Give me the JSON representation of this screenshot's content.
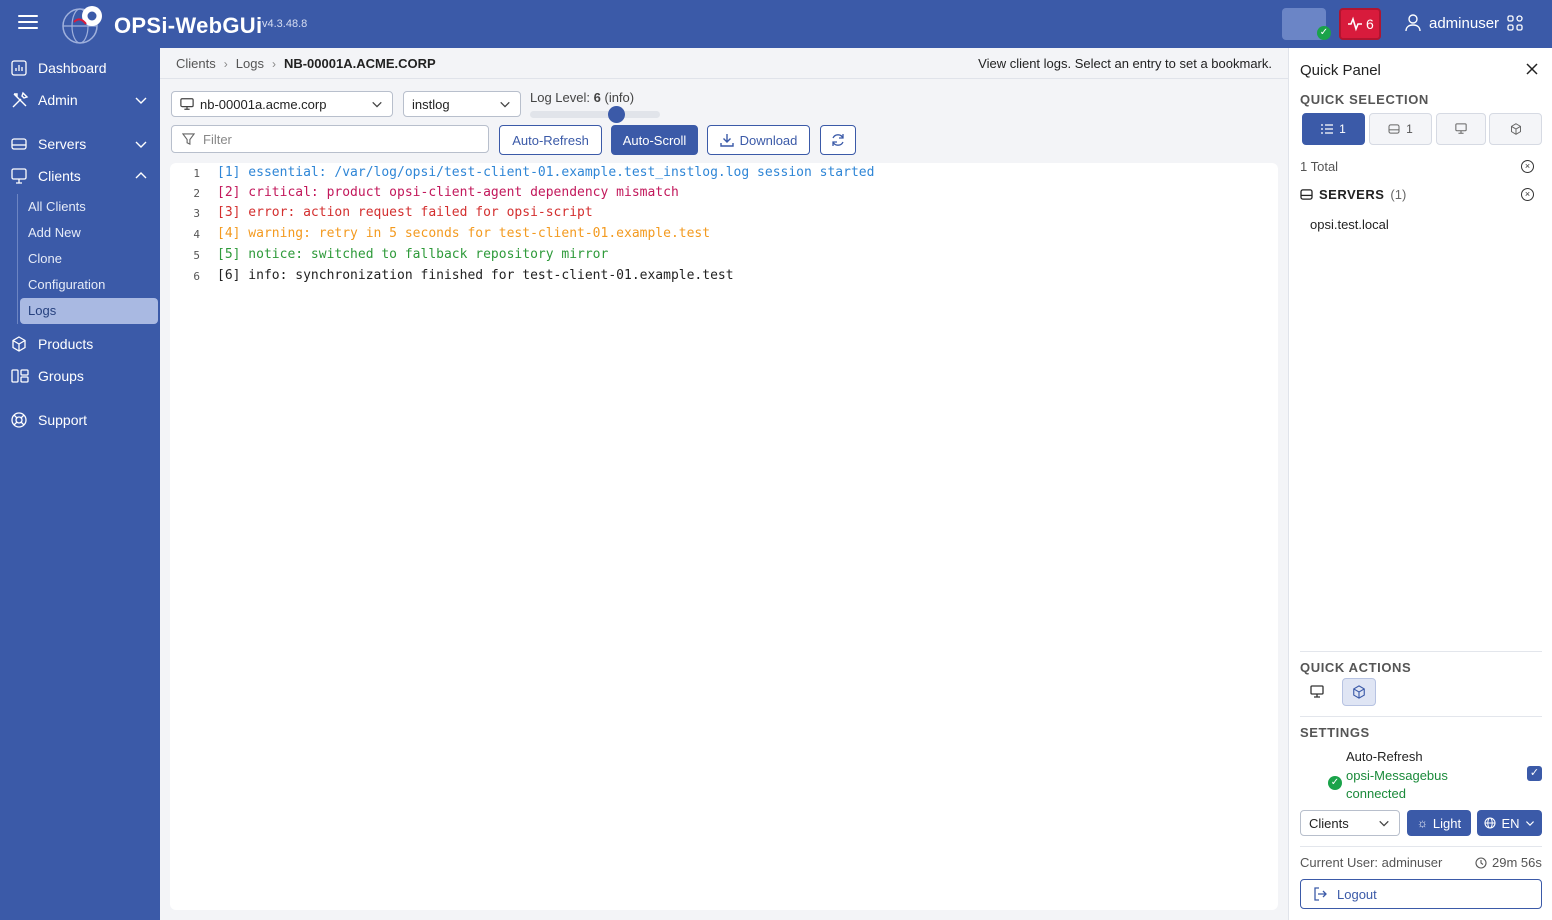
{
  "header": {
    "app_name": "OPSi-WebGUi",
    "version": "v4.3.48.8",
    "alert_count": "6",
    "username": "adminuser"
  },
  "sidebar": {
    "items": [
      {
        "label": "Dashboard",
        "icon": "dashboard-icon"
      },
      {
        "label": "Admin",
        "icon": "admin-tools-icon"
      },
      {
        "label": "Servers",
        "icon": "server-icon"
      },
      {
        "label": "Clients",
        "icon": "monitor-icon"
      },
      {
        "label": "Products",
        "icon": "package-icon"
      },
      {
        "label": "Groups",
        "icon": "groups-icon"
      },
      {
        "label": "Support",
        "icon": "lifebuoy-icon"
      }
    ],
    "client_subitems": [
      "All Clients",
      "Add New",
      "Clone",
      "Configuration",
      "Logs"
    ],
    "active_subitem": "Logs"
  },
  "breadcrumb": {
    "items": [
      "Clients",
      "Logs"
    ],
    "current": "NB-00001A.ACME.CORP"
  },
  "hint_text": "View client logs. Select an entry to set a bookmark.",
  "toolbar": {
    "client_select": "nb-00001a.acme.corp",
    "log_type_select": "instlog",
    "log_level_label": "Log Level:",
    "log_level_value": "6",
    "log_level_name": "(info)",
    "log_level_max": 9,
    "filter_placeholder": "Filter",
    "auto_refresh_label": "Auto-Refresh",
    "auto_scroll_label": "Auto-Scroll",
    "download_label": "Download"
  },
  "log_lines": [
    {
      "num": "1",
      "text": "[1] essential: /var/log/opsi/test-client-01.example.test_instlog.log session started",
      "color": "#2f86d6"
    },
    {
      "num": "2",
      "text": "[2] critical: product opsi-client-agent dependency mismatch",
      "color": "#c2185b"
    },
    {
      "num": "3",
      "text": "[3] error: action request failed for opsi-script",
      "color": "#d32f2f"
    },
    {
      "num": "4",
      "text": "[4] warning: retry in 5 seconds for test-client-01.example.test",
      "color": "#f39a1f"
    },
    {
      "num": "5",
      "text": "[5] notice: switched to fallback repository mirror",
      "color": "#2e9a3a"
    },
    {
      "num": "6",
      "text": "[6] info: synchronization finished for test-client-01.example.test",
      "color": "#222222"
    }
  ],
  "quick_panel": {
    "title": "Quick Panel",
    "quick_selection_title": "QUICK SELECTION",
    "selection_buttons": [
      {
        "icon": "list-icon",
        "count": "1"
      },
      {
        "icon": "server-icon",
        "count": "1"
      },
      {
        "icon": "monitor-icon",
        "count": ""
      },
      {
        "icon": "package-icon",
        "count": ""
      }
    ],
    "total_label": "1 Total",
    "servers_label": "SERVERS",
    "servers_count": "(1)",
    "server_entries": [
      "opsi.test.local"
    ],
    "quick_actions_title": "QUICK ACTIONS",
    "settings_title": "SETTINGS",
    "auto_refresh_label": "Auto-Refresh",
    "messagebus_status": "opsi-Messagebus connected",
    "context_select": "Clients",
    "theme_label": "Light",
    "language_label": "EN",
    "current_user_label": "Current User: adminuser",
    "session_time": "29m 56s",
    "logout_label": "Logout"
  },
  "colors": {
    "brand": "#3b5aa8",
    "alert": "#d81b3c",
    "success": "#1aa34a"
  }
}
